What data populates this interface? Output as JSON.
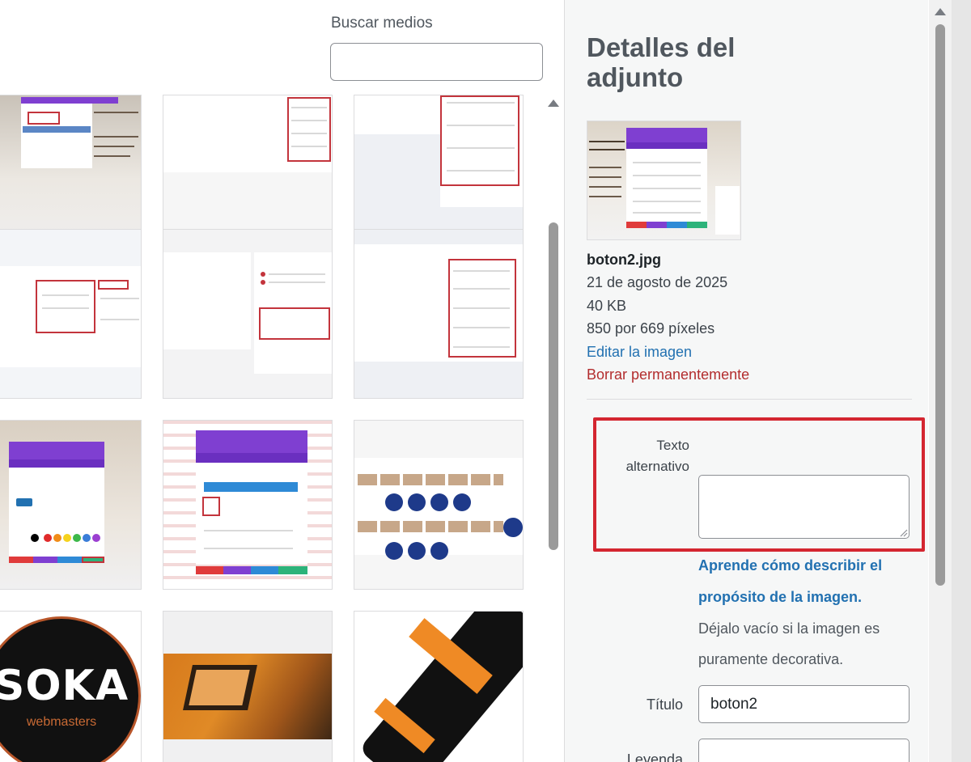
{
  "search": {
    "label": "Buscar medios",
    "value": "",
    "placeholder": ""
  },
  "grid": {
    "thumbnails": [
      {
        "id": "thumb-1"
      },
      {
        "id": "thumb-2"
      },
      {
        "id": "thumb-3"
      },
      {
        "id": "thumb-4"
      },
      {
        "id": "thumb-5"
      },
      {
        "id": "thumb-6"
      },
      {
        "id": "thumb-7"
      },
      {
        "id": "thumb-8"
      },
      {
        "id": "thumb-9"
      },
      {
        "id": "thumb-10"
      },
      {
        "id": "thumb-11"
      },
      {
        "id": "thumb-12"
      }
    ],
    "soka_logo_text": "SOKA",
    "soka_logo_sub": "webmasters"
  },
  "details": {
    "title": "Detalles del adjunto",
    "filename": "boton2.jpg",
    "date": "21 de agosto de 2025",
    "filesize": "40 KB",
    "dimensions": "850 por 669 píxeles",
    "edit_link": "Editar la imagen",
    "delete_link": "Borrar permanentemente"
  },
  "fields": {
    "alt_label": "Texto alternativo",
    "alt_value": "",
    "alt_help_link": "Aprende cómo describir el propósito de la imagen.",
    "alt_help_note": "Déjalo vacío si la imagen es puramente decorativa.",
    "title_label": "Título",
    "title_value": "boton2",
    "caption_label": "Leyenda",
    "caption_value": ""
  },
  "colors": {
    "link": "#2271b1",
    "delete": "#b32d2e",
    "highlight": "#d42630",
    "purple": "#7f3fd1"
  },
  "icons": {
    "scroll_up": "triangle-up-icon",
    "resize": "resize-grip-icon"
  }
}
